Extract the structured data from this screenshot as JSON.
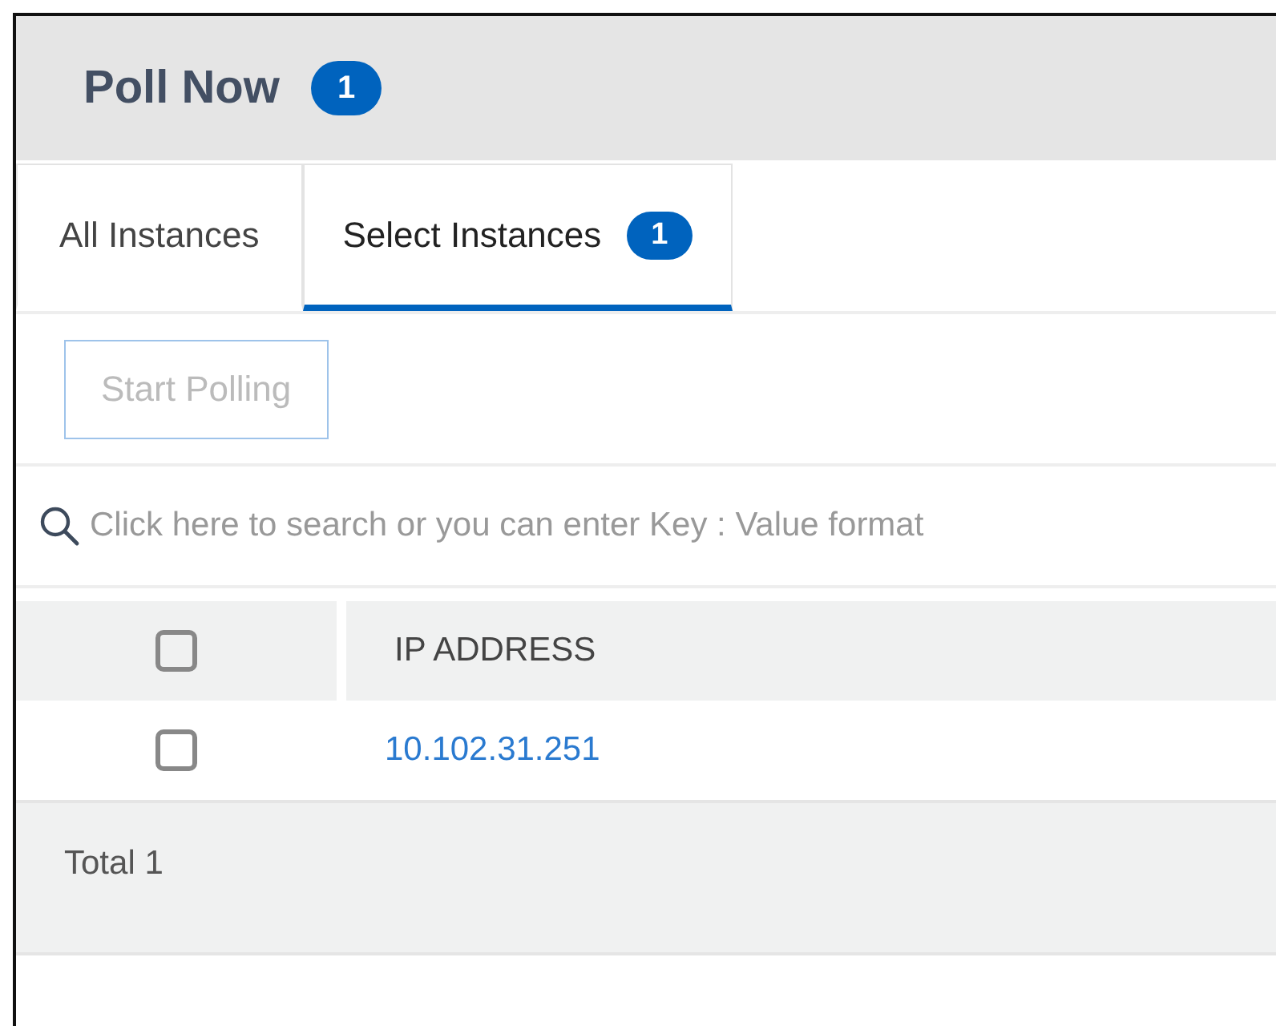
{
  "panel": {
    "title": "Poll Now",
    "badge": "1"
  },
  "tabs": [
    {
      "label": "All Instances",
      "selected": false
    },
    {
      "label": "Select Instances",
      "selected": true,
      "badge": "1"
    }
  ],
  "toolbar": {
    "button": {
      "label": "Start Polling",
      "disabled": true
    }
  },
  "search": {
    "placeholder": "Click here to search or you can enter Key : Value format"
  },
  "table": {
    "select_all_checked": false,
    "columns": [
      "IP ADDRESS"
    ],
    "rows": [
      {
        "checked": false,
        "ip": "10.102.31.251"
      }
    ]
  },
  "footer": {
    "total": "Total 1"
  }
}
